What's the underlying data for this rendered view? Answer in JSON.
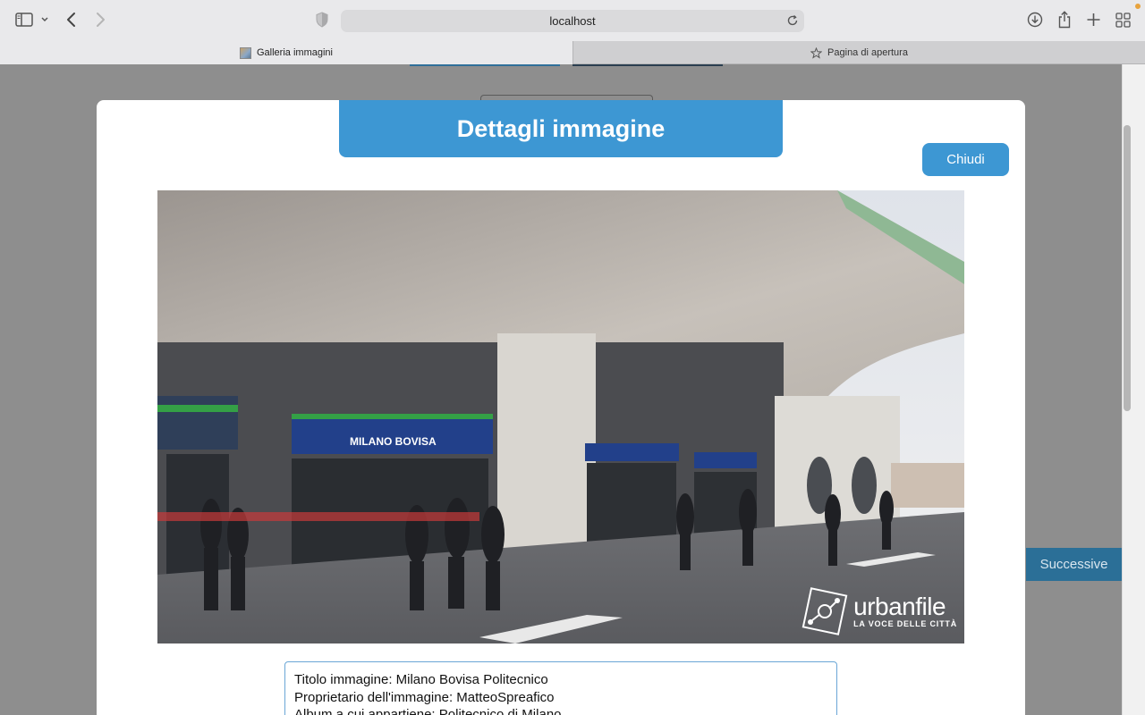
{
  "browser": {
    "url": "localhost",
    "tabs": [
      {
        "label": "Galleria immagini",
        "active": true
      },
      {
        "label": "Pagina di apertura",
        "active": false
      }
    ]
  },
  "page": {
    "next_label": "Successive"
  },
  "modal": {
    "title": "Dettagli immagine",
    "close_label": "Chiudi",
    "image": {
      "station_sign": "MILANO BOVISA",
      "watermark_brand": "urbanfile",
      "watermark_tagline": "LA VOCE DELLE CITTÀ"
    },
    "info": {
      "title_line": "Titolo immagine: Milano Bovisa Politecnico",
      "owner_line": "Proprietario dell'immagine: MatteoSpreafico",
      "album_line": "Album a cui appartiene: Politecnico di Milano"
    }
  },
  "colors": {
    "accent": "#3d97d3",
    "overlay": "#8e8e8e",
    "next_button": "#2b6f97"
  }
}
